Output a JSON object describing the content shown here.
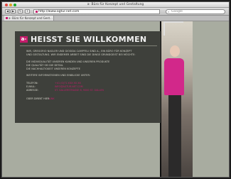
{
  "browser": {
    "window_title": "a- Büro für Konzept und Gestaltung",
    "address": "http://www.agtur.net.com",
    "search_placeholder": "Google",
    "tab_label": "a- Büro für Konzept und Gest...",
    "back_glyph": "◀",
    "forward_glyph": "▶",
    "reload_glyph": "↻",
    "add_glyph": "+",
    "search_glyph": "⌕"
  },
  "page": {
    "logo_text": "a-",
    "heading": "HEISST SIE WILLKOMMEN",
    "intro": [
      "WIR, GREGORIO NAGLER UND GIOSIDA CAMPFELI SIND A-, EIN BÜRO FÜR KONZEPT",
      "UND GESTALTUNG. WIR ENDEMER ARBEIT SIND DIE DINGE GRUNDGEIST BEI MÖCHTE:"
    ],
    "mid": [
      "DIE INDIVIDUALITÄT UNSEREN KUNDEN UND UNSEREN PRODUKTE",
      "DIE QUALITÄT SEI DIE DETAIL",
      "DIE NACHHALTIGKEIT UNSEREN KONZEPTE"
    ],
    "more_info": "WEITERE INFORMATIONEN UND EINBLICKE UNTER:",
    "contact": [
      {
        "label": "TELEFON:",
        "value": "+41 (0)71 XXX XX XX"
      },
      {
        "label": "E-MAIL:",
        "value": "INFO@AGTUR.NET.COM"
      },
      {
        "label": "ADRESSE:",
        "value": "ST. GALLERSTRASSE 8, 9000 ST. GALLEN"
      }
    ],
    "footer": "ODER DIREKT HIER:",
    "footer_link": "LINK"
  },
  "colors": {
    "accent": "#c51b6b",
    "panel": "#3e403b",
    "background": "#a8aca0"
  }
}
